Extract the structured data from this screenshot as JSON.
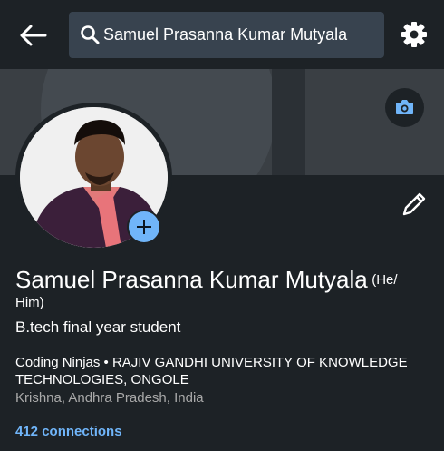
{
  "search": {
    "value": "Samuel Prasanna Kumar Mutyala"
  },
  "profile": {
    "name": "Samuel Prasanna Kumar Mutyala",
    "pronouns_part1": "(He/",
    "pronouns_part2": "Him)",
    "headline": "B.tech final year student",
    "education": "Coding Ninjas • RAJIV GANDHI UNIVERSITY OF KNOWLEDGE TECHNOLOGIES, ONGOLE",
    "location": "Krishna, Andhra Pradesh, India",
    "connections": "412 connections"
  },
  "colors": {
    "background": "#1d2226",
    "search_bg": "#38434f",
    "accent": "#70b5f9",
    "muted_text": "#a9a9a9",
    "banner": "#3a3f44"
  },
  "icons": {
    "back": "arrow-left-icon",
    "search": "search-icon",
    "settings": "gear-icon",
    "camera": "camera-icon",
    "add": "plus-icon",
    "edit": "pencil-icon"
  }
}
